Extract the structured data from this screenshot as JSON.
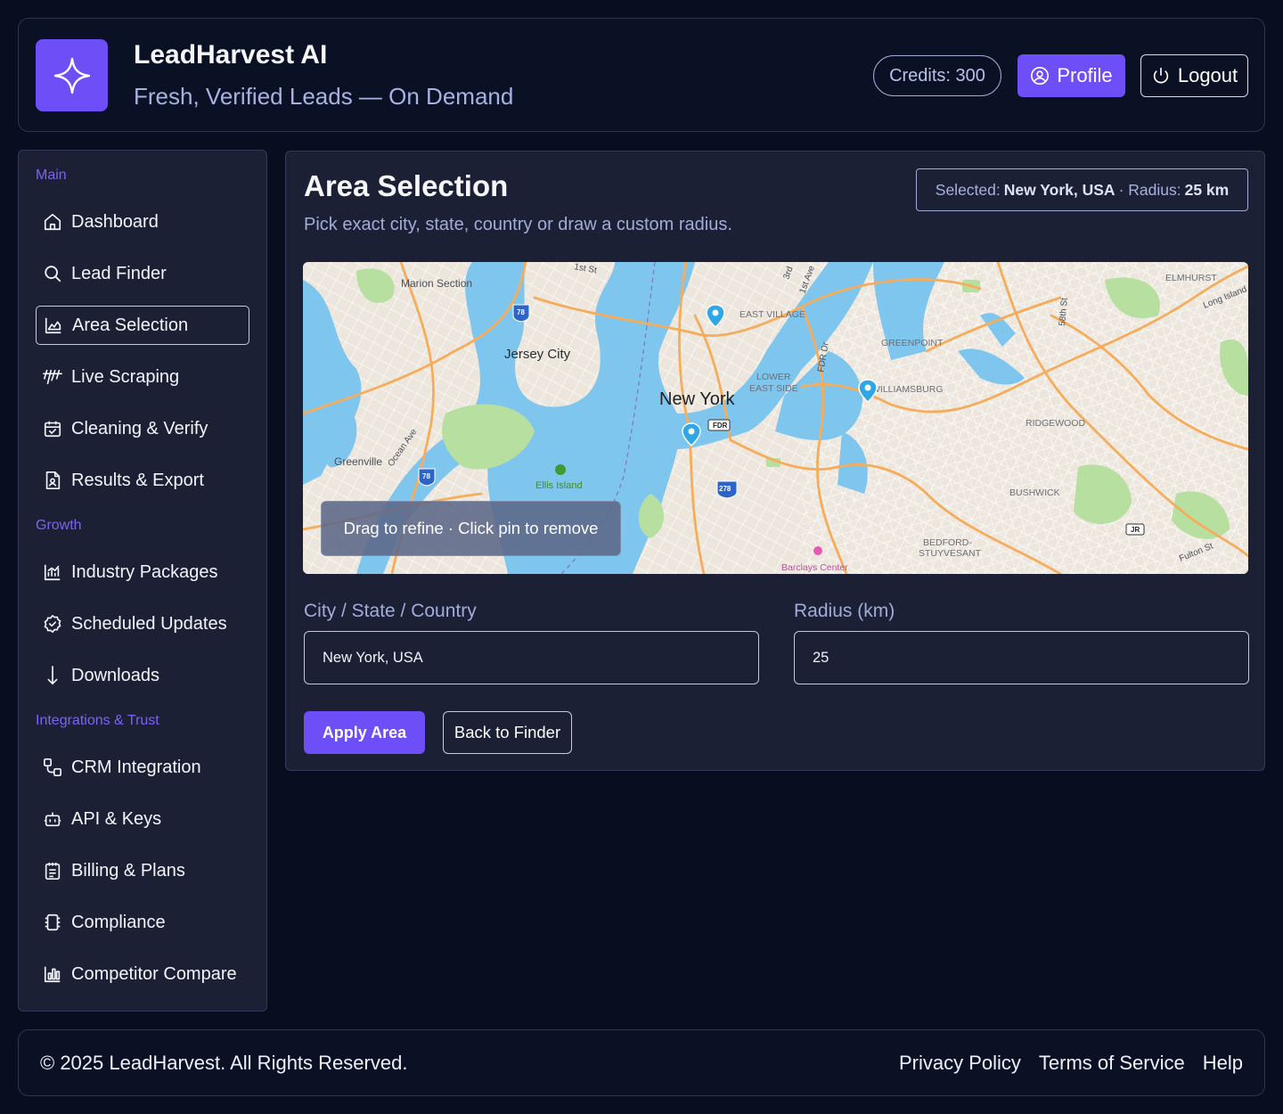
{
  "header": {
    "app_title": "LeadHarvest AI",
    "app_subtitle": "Fresh, Verified Leads — On Demand",
    "credits": "Credits: 300",
    "profile_label": "Profile",
    "logout_label": "Logout",
    "logo_icon": "sparkle-icon"
  },
  "sidebar": {
    "sections": [
      {
        "label": "Main",
        "items": [
          {
            "label": "Dashboard",
            "icon": "home-icon"
          },
          {
            "label": "Lead Finder",
            "icon": "search-icon"
          },
          {
            "label": "Area Selection",
            "icon": "chart-area-icon",
            "active": true
          },
          {
            "label": "Live Scraping",
            "icon": "scrape-lines-icon"
          },
          {
            "label": "Cleaning & Verify",
            "icon": "calendar-check-icon"
          },
          {
            "label": "Results & Export",
            "icon": "file-user-icon"
          }
        ]
      },
      {
        "label": "Growth",
        "items": [
          {
            "label": "Industry Packages",
            "icon": "chart-bars-icon"
          },
          {
            "label": "Scheduled Updates",
            "icon": "check-badge-icon"
          },
          {
            "label": "Downloads",
            "icon": "arrow-down-icon"
          }
        ]
      },
      {
        "label": "Integrations & Trust",
        "items": [
          {
            "label": "CRM Integration",
            "icon": "nodes-icon"
          },
          {
            "label": "API & Keys",
            "icon": "bot-icon"
          },
          {
            "label": "Billing & Plans",
            "icon": "notepad-icon"
          },
          {
            "label": "Compliance",
            "icon": "chip-icon"
          },
          {
            "label": "Competitor Compare",
            "icon": "bar-compare-icon"
          }
        ]
      }
    ]
  },
  "main": {
    "title": "Area Selection",
    "description": "Pick exact city, state, country or draw a custom radius.",
    "selected_prefix": "Selected:",
    "selected_area": "New York, USA",
    "radius_prefix": "· Radius:",
    "radius_value": "25 km",
    "map": {
      "hint": "Drag to refine · Click pin to remove",
      "labels": {
        "new_york": "New York",
        "jersey_city": "Jersey City",
        "marion_section": "Marion Section",
        "greenville": "Greenville",
        "ocean_ave": "Ocean Ave",
        "ellis_island": "Ellis Island",
        "east_village": "EAST VILLAGE",
        "lower": "LOWER",
        "east_side": "EAST SIDE",
        "greenpoint": "GREENPOINT",
        "williamsburg": "WILLIAMSBURG",
        "ridgewood": "RIDGEWOOD",
        "bushwick": "BUSHWICK",
        "bedford": "BEDFORD-",
        "stuyvesant": "STUYVESANT",
        "barclays": "Barclays Center",
        "elmhurst": "ELMHURST",
        "long_island": "Long Island",
        "fulton": "Fulton St",
        "fdr_dr": "FDR Dr",
        "first_st": "1st St",
        "third": "3rd",
        "first_ave": "1st Ave",
        "fifty_eighth": "58th St",
        "fdr": "FDR",
        "jr": "JR",
        "i78a": "78",
        "i78b": "78",
        "i278": "278"
      }
    },
    "location_label": "City / State / Country",
    "location_value": "New York, USA",
    "radius_label": "Radius (km)",
    "radius_input_value": "25",
    "apply_label": "Apply Area",
    "back_label": "Back to Finder"
  },
  "footer": {
    "copyright": "© 2025 LeadHarvest. All Rights Reserved.",
    "links": [
      "Privacy Policy",
      "Terms of Service",
      "Help"
    ]
  },
  "colors": {
    "accent": "#6d4ef7",
    "background": "#080e1f",
    "panel": "#1b2035",
    "water": "#7fc6ee",
    "park": "#b6dfa0",
    "road": "#f6ad5b"
  }
}
